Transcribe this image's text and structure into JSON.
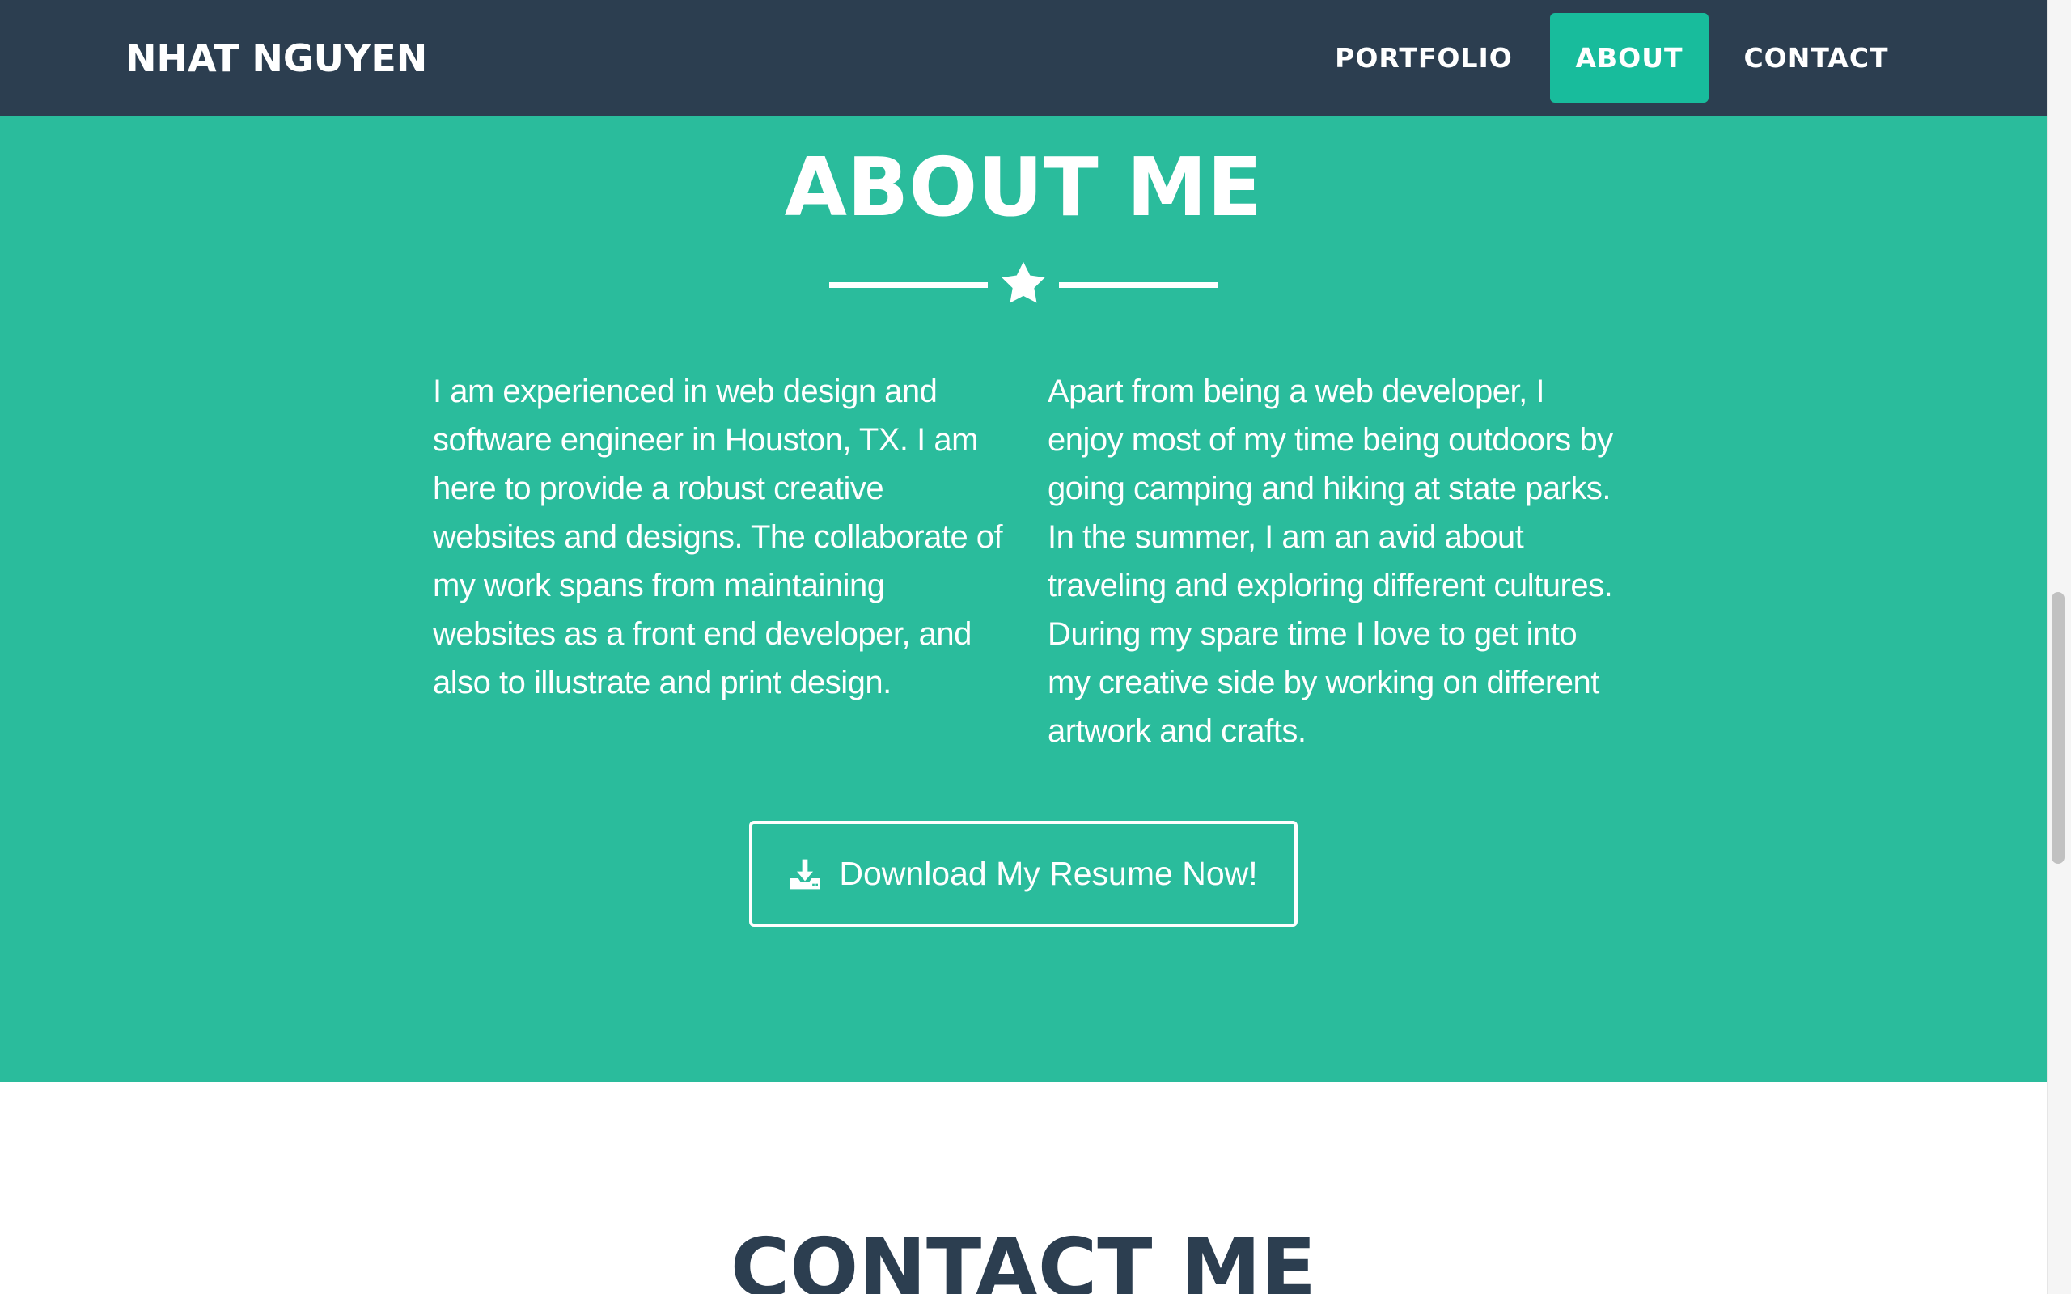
{
  "navbar": {
    "brand": "NHAT NGUYEN",
    "items": [
      {
        "label": "PORTFOLIO",
        "active": false
      },
      {
        "label": "ABOUT",
        "active": true
      },
      {
        "label": "CONTACT",
        "active": false
      }
    ]
  },
  "about": {
    "title": "ABOUT ME",
    "divider_icon": "star-icon",
    "paragraph_left": "I am experienced in web design and software engineer in Houston, TX. I am here to provide a robust creative websites and designs. The collaborate of my work spans from maintaining websites as a front end developer, and also to illustrate and print design.",
    "paragraph_right": "Apart from being a web developer, I enjoy most of my time being outdoors by going camping and hiking at state parks. In the summer, I am an avid about traveling and exploring different cultures. During my spare time I love to get into my creative side by working on different artwork and crafts.",
    "resume_button": {
      "label": "Download My Resume Now!",
      "icon": "download-icon"
    }
  },
  "contact": {
    "title": "CONTACT ME"
  },
  "colors": {
    "navbar_bg": "#2c3e50",
    "accent": "#18bc9c",
    "section_bg": "#2abc9c",
    "text_light": "#ffffff",
    "text_dark": "#2c3e50"
  }
}
